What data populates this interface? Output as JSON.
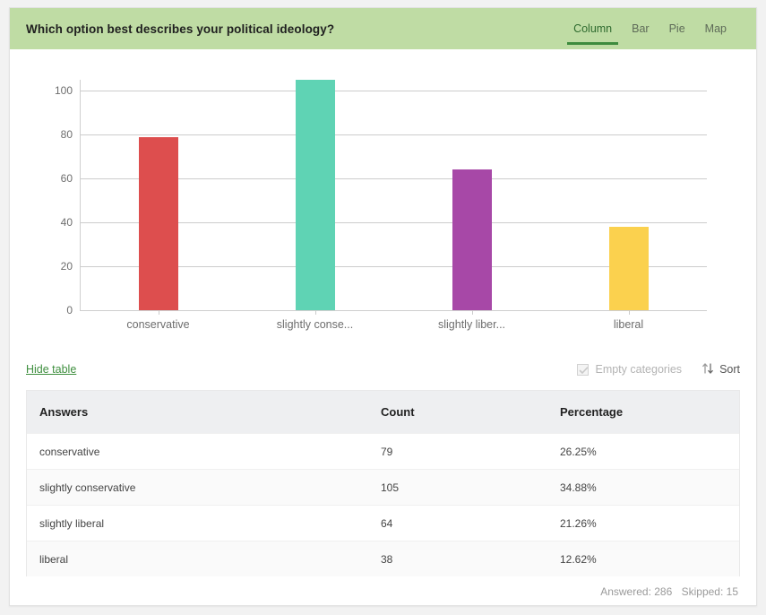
{
  "header": {
    "question": "Which option best describes your political ideology?",
    "tabs": [
      {
        "label": "Column",
        "active": true
      },
      {
        "label": "Bar",
        "active": false
      },
      {
        "label": "Pie",
        "active": false
      },
      {
        "label": "Map",
        "active": false
      }
    ],
    "band_color": "#bfdca4",
    "active_tab_underline_color": "#3d8b3d"
  },
  "chart_data": {
    "type": "bar",
    "title": "Which option best describes your political ideology?",
    "xlabel": "",
    "ylabel": "",
    "categories": [
      "conservative",
      "slightly conservative",
      "slightly liberal",
      "liberal"
    ],
    "tick_labels": [
      "conservative",
      "slightly conse...",
      "slightly liber...",
      "liberal"
    ],
    "values": [
      79,
      105,
      64,
      38
    ],
    "colors": [
      "#dd4e4e",
      "#5fd3b4",
      "#a748a7",
      "#fbd14e"
    ],
    "ylim": [
      0,
      105
    ],
    "yticks": [
      100,
      80,
      60,
      40,
      20,
      0
    ],
    "grid": true,
    "legend": false
  },
  "controls": {
    "hide_table_label": "Hide table",
    "empty_categories_label": "Empty categories",
    "empty_categories_checked": true,
    "sort_label": "Sort"
  },
  "table": {
    "columns": [
      "Answers",
      "Count",
      "Percentage"
    ],
    "rows": [
      {
        "answer": "conservative",
        "count": "79",
        "percentage": "26.25%"
      },
      {
        "answer": "slightly conservative",
        "count": "105",
        "percentage": "34.88%"
      },
      {
        "answer": "slightly liberal",
        "count": "64",
        "percentage": "21.26%"
      },
      {
        "answer": "liberal",
        "count": "38",
        "percentage": "12.62%"
      }
    ]
  },
  "footer": {
    "answered": "Answered: 286",
    "skipped": "Skipped: 15"
  }
}
